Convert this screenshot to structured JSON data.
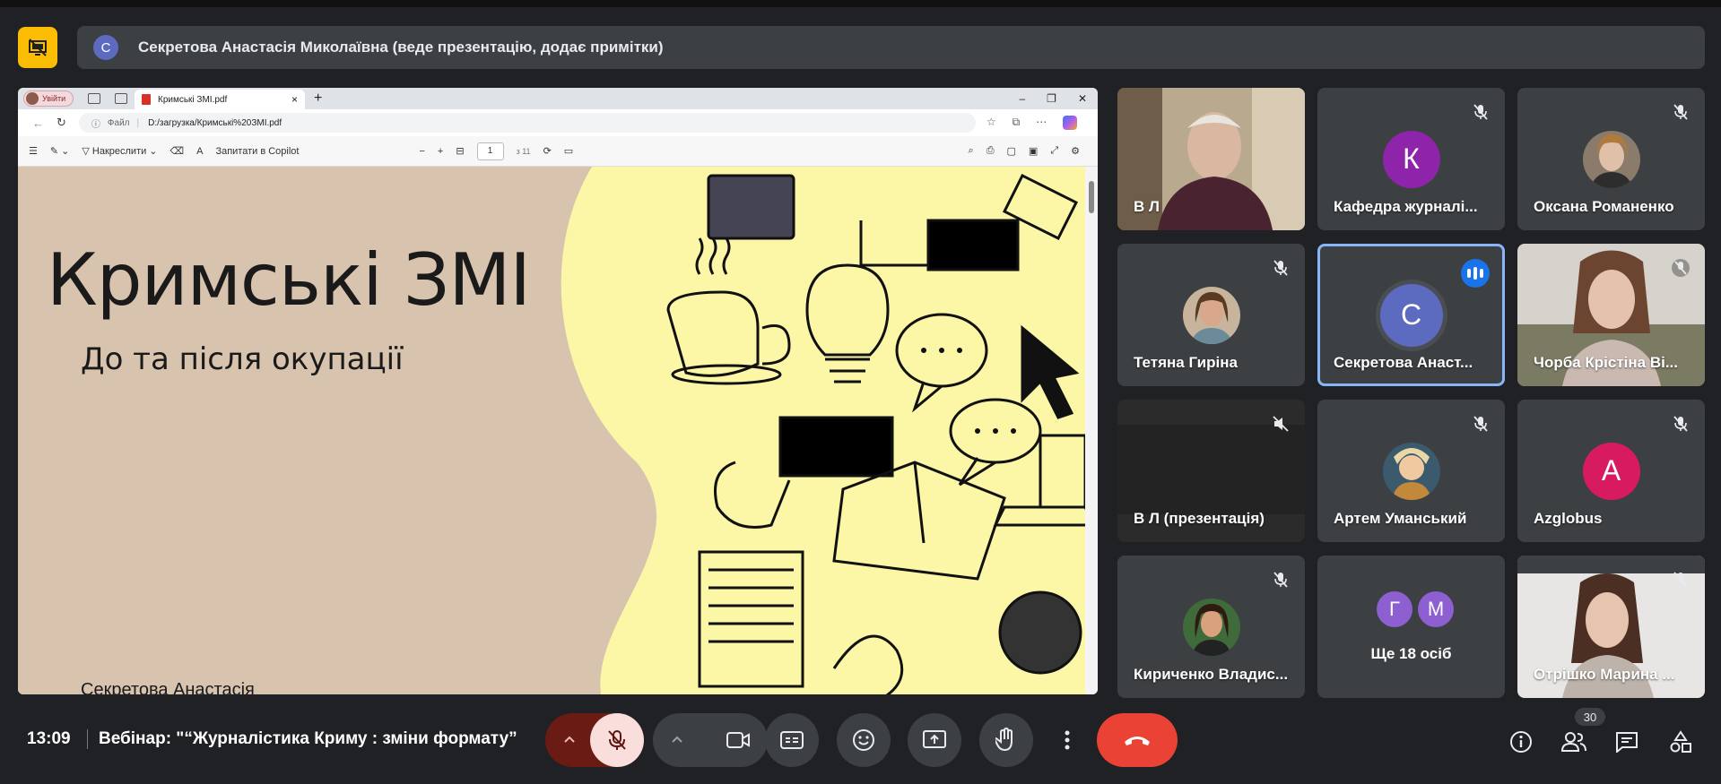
{
  "banner": {
    "avatar_letter": "С",
    "presenter_text": "Секретова Анастасія Миколаївна (веде презентацію, додає примітки)"
  },
  "browser": {
    "profile_label": "Увійти",
    "tab_title": "Кримські ЗМІ.pdf",
    "address_label": "Файл",
    "url": "D:/загрузка/Кримські%20ЗМІ.pdf",
    "toolbar": {
      "draw_label": "Накреслити",
      "copilot_label": "Запитати в Copilot",
      "page_value": "1",
      "page_total": "з 11"
    }
  },
  "slide": {
    "title": "Кримські ЗМІ",
    "subtitle": "До та після окупації",
    "author_partial": "Секретова Анастасія"
  },
  "participants": [
    {
      "name": "В Л",
      "kind": "video",
      "muted": false
    },
    {
      "name": "Кафедра журналі...",
      "kind": "letter",
      "letter": "К",
      "color": "#8e24aa",
      "muted": true
    },
    {
      "name": "Оксана Романенко",
      "kind": "photo",
      "muted": true
    },
    {
      "name": "Тетяна Гиріна",
      "kind": "photo",
      "muted": true
    },
    {
      "name": "Секретова Анаст...",
      "kind": "letter",
      "letter": "С",
      "color": "#5c6bc0",
      "muted": false,
      "speaking": true
    },
    {
      "name": "Чорба Крістіна Ві...",
      "kind": "video",
      "muted": true
    },
    {
      "name": "В Л (презентація)",
      "kind": "blank",
      "muted": true
    },
    {
      "name": "Артем Уманський",
      "kind": "photo",
      "muted": true
    },
    {
      "name": "Azglobus",
      "kind": "letter",
      "letter": "A",
      "color": "#d81b60",
      "muted": true
    },
    {
      "name": "Кириченко Владис...",
      "kind": "photo",
      "muted": true
    },
    {
      "name": "Ще 18 осіб",
      "kind": "more",
      "letters": [
        "Г",
        "М"
      ]
    },
    {
      "name": "Отрішко Марина ...",
      "kind": "video",
      "muted": true
    }
  ],
  "bottom": {
    "time": "13:09",
    "meeting_title": "Вебінар: \"“Журналістика Криму : зміни формату”",
    "participant_count": "30"
  },
  "colors": {
    "background": "#202124",
    "tile": "#3c4043",
    "hangup": "#ea4335",
    "present_accent": "#fbbc04",
    "active_border": "#8ab4f8"
  },
  "icons": [
    "present-off-icon",
    "mic-off-icon",
    "camera-icon",
    "captions-icon",
    "emoji-icon",
    "present-screen-icon",
    "raise-hand-icon",
    "more-vert-icon",
    "hangup-icon",
    "info-icon",
    "people-icon",
    "chat-icon",
    "activities-icon"
  ]
}
